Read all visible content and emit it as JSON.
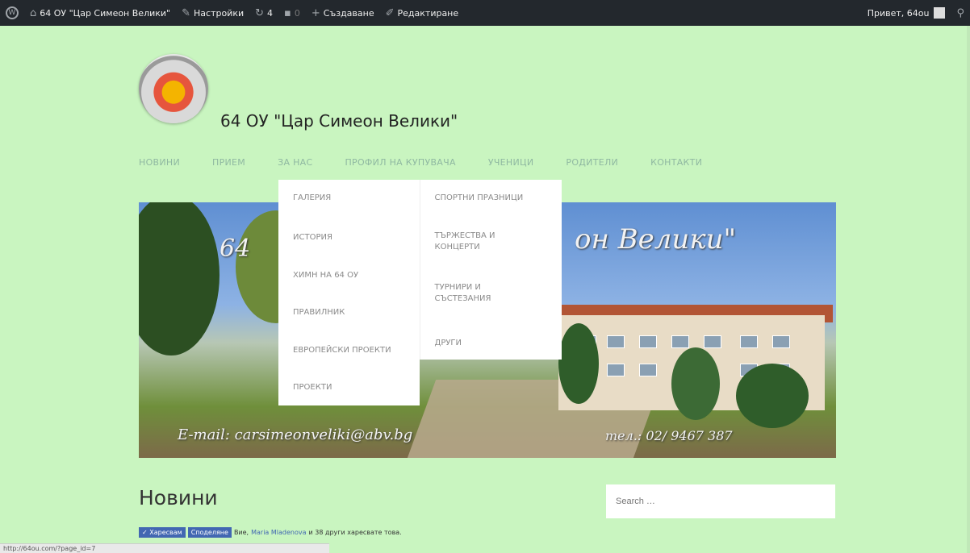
{
  "adminbar": {
    "wp_logo": "wp-logo-icon",
    "site_name": "64 ОУ \"Цар Симеон Велики\"",
    "settings": "Настройки",
    "updates_count": "4",
    "comments_count": "0",
    "create": "Създаване",
    "edit": "Редактиране",
    "greeting": "Привет, 64ou"
  },
  "header": {
    "site_title": "64 ОУ \"Цар Симеон Велики\""
  },
  "nav": {
    "items": [
      "НОВИНИ",
      "ПРИЕМ",
      "ЗА НАС",
      "ПРОФИЛ НА КУПУВАЧА",
      "УЧЕНИЦИ",
      "РОДИТЕЛИ",
      "КОНТАКТИ"
    ]
  },
  "dropdown": {
    "col1": [
      "ГАЛЕРИЯ",
      "ИСТОРИЯ",
      "ХИМН НА 64 ОУ",
      "ПРАВИЛНИК",
      "ЕВРОПЕЙСКИ ПРОЕКТИ",
      "ПРОЕКТИ"
    ],
    "col2": [
      "СПОРТНИ ПРАЗНИЦИ",
      "ТЪРЖЕСТВА И КОНЦЕРТИ",
      "ТУРНИРИ И СЪСТЕЗАНИЯ",
      "ДРУГИ"
    ]
  },
  "banner": {
    "title_left": "64",
    "title_right": "он Велики\"",
    "email": "E-mail: carsimeonveliki@abv.bg",
    "phone": "тел.: 02/ 9467 387"
  },
  "main": {
    "heading": "Новини",
    "search_placeholder": "Search …"
  },
  "facebook": {
    "like": "Харесвам",
    "share": "Споделяне",
    "text_prefix": "Вие,",
    "friend": "Maria Mladenova",
    "text_suffix": "и 38 други харесвате това."
  },
  "status": {
    "url": "http://64ou.com/?page_id=7"
  },
  "colors": {
    "page_bg": "#c9f5c0",
    "adminbar_bg": "#23282d",
    "nav_text": "#8fb8a1"
  }
}
